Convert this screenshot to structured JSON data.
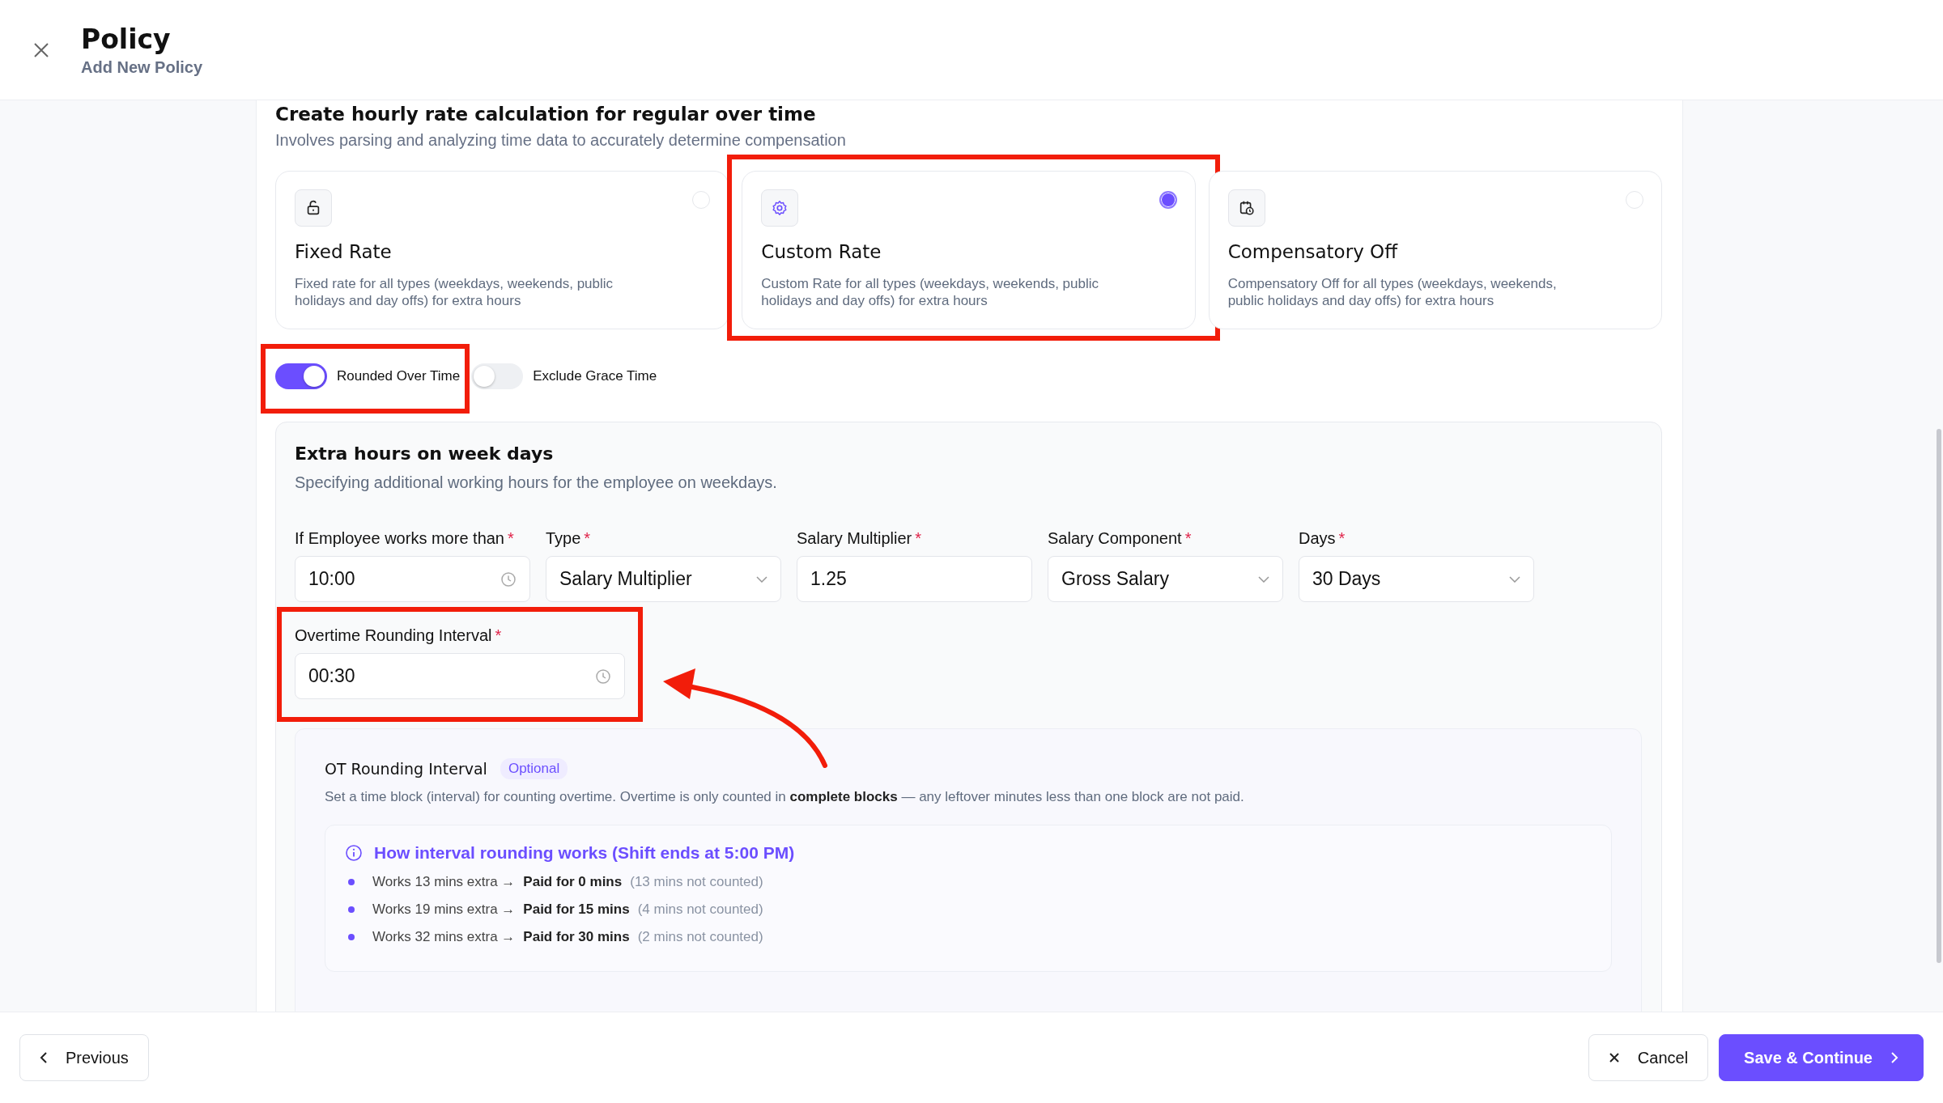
{
  "header": {
    "title": "Policy",
    "subtitle": "Add New Policy"
  },
  "section": {
    "title": "Create hourly rate calculation for regular over time",
    "description": "Involves parsing and analyzing time data to accurately determine compensation"
  },
  "rate_options": [
    {
      "kind": "padlock",
      "title": "Fixed Rate",
      "description": "Fixed rate for all types (weekdays, weekends, public holidays and day offs) for extra hours",
      "selected": false,
      "highlighted": false
    },
    {
      "kind": "gear",
      "title": "Custom Rate",
      "description": "Custom Rate for all types (weekdays, weekends, public holidays and day offs) for extra hours",
      "selected": true,
      "highlighted": true
    },
    {
      "kind": "calendar",
      "title": "Compensatory Off",
      "description": "Compensatory Off for all types (weekdays, weekends, public holidays and day offs) for extra hours",
      "selected": false,
      "highlighted": false
    }
  ],
  "toggles": [
    {
      "label": "Rounded Over Time",
      "on": true,
      "highlighted": true
    },
    {
      "label": "Exclude Grace Time",
      "on": false,
      "highlighted": false
    }
  ],
  "weekday_panel": {
    "title": "Extra hours on week days",
    "description": "Specifying additional working hours for the employee on weekdays.",
    "fields": [
      {
        "kind": "time",
        "label": "If Employee works more than",
        "required_mark": "*",
        "value": "10:00"
      },
      {
        "kind": "select",
        "label": "Type",
        "required_mark": "*",
        "value": "Salary Multiplier"
      },
      {
        "kind": "text",
        "label": "Salary Multiplier",
        "required_mark": "*",
        "value": "1.25"
      },
      {
        "kind": "select",
        "label": "Salary Component",
        "required_mark": "*",
        "value": "Gross Salary"
      },
      {
        "kind": "select",
        "label": "Days",
        "required_mark": "*",
        "value": "30 Days"
      }
    ],
    "rounding_field": {
      "kind": "time",
      "label": "Overtime Rounding Interval",
      "required_mark": "*",
      "value": "00:30",
      "highlighted": true,
      "arrow": true
    }
  },
  "ot_info": {
    "title": "OT Rounding Interval",
    "badge": "Optional",
    "description": "Set a time block (interval) for counting overtime. Overtime is only counted in **complete blocks** — any leftover minutes less than one block are not paid.",
    "how": {
      "title": "How interval rounding works (Shift ends at 5:00 PM)",
      "items": [
        {
          "text": "Works 13 mins extra →",
          "paid": "Paid for 0 mins",
          "note": "(13 mins not counted)"
        },
        {
          "text": "Works 19 mins extra →",
          "paid": "Paid for 15 mins",
          "note": "(4 mins not counted)"
        },
        {
          "text": "Works 32 mins extra →",
          "paid": "Paid for 30 mins",
          "note": "(2 mins not counted)"
        }
      ]
    }
  },
  "footer": {
    "previous": "Previous",
    "cancel": "Cancel",
    "save": "Save & Continue"
  }
}
